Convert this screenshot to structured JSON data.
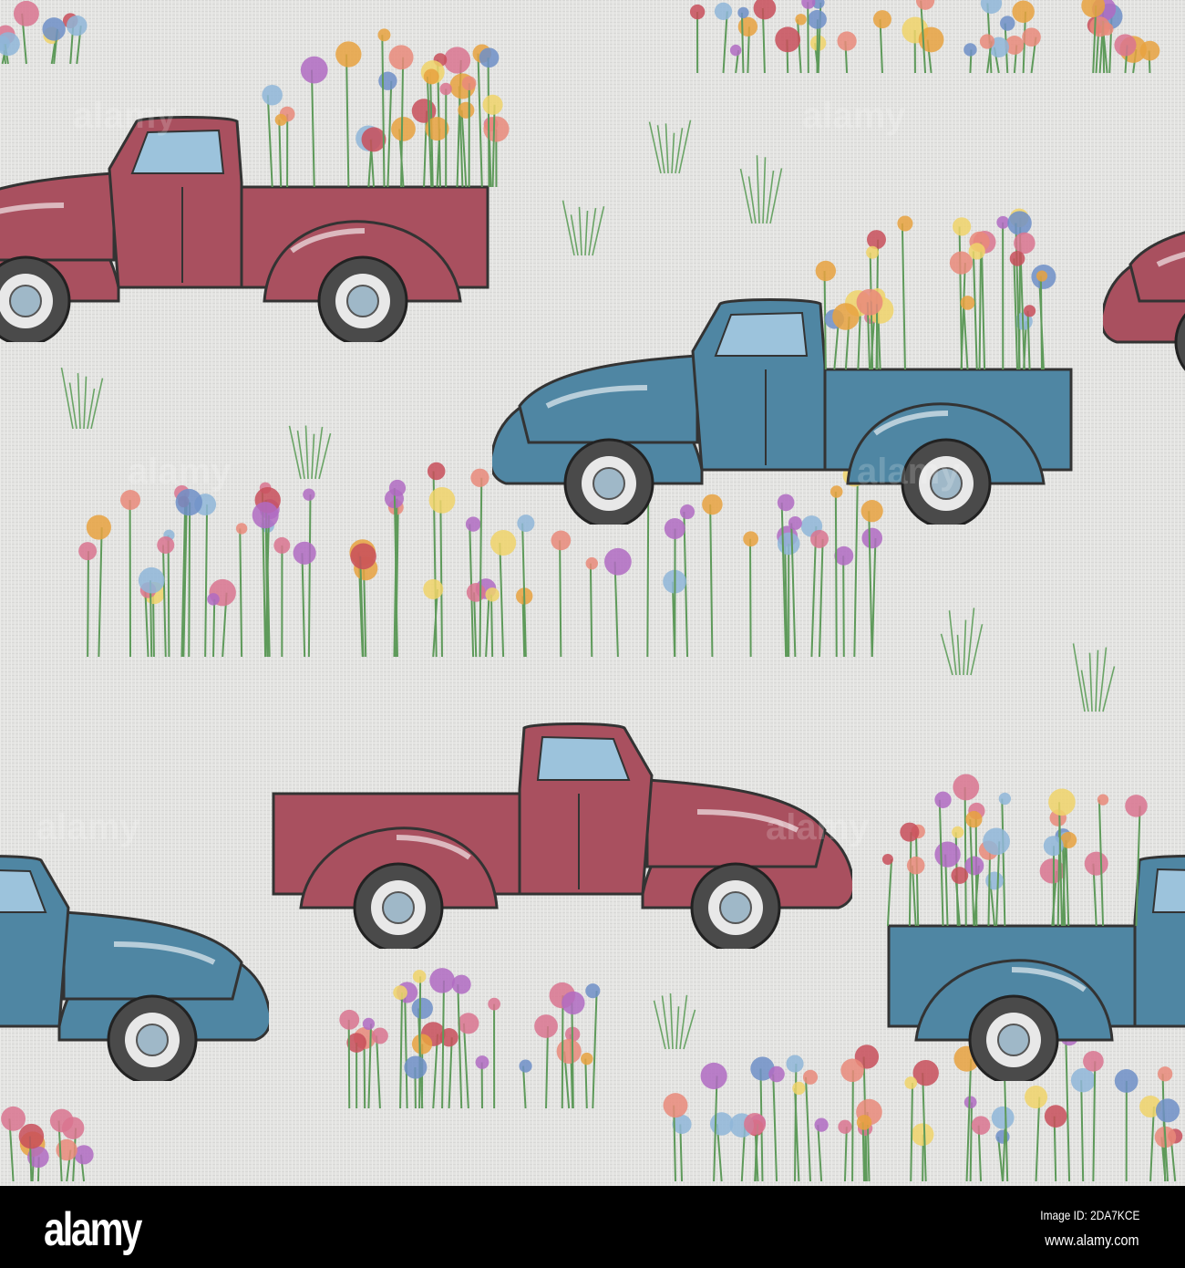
{
  "watermark": {
    "logo": "alamy",
    "image_id": "Image ID: 2DA7KCE",
    "site": "www.alamy.com"
  },
  "colors": {
    "background": "#e4e4e2",
    "red_truck": "#a9505f",
    "blue_truck": "#4f86a3",
    "footer": "#000000"
  }
}
